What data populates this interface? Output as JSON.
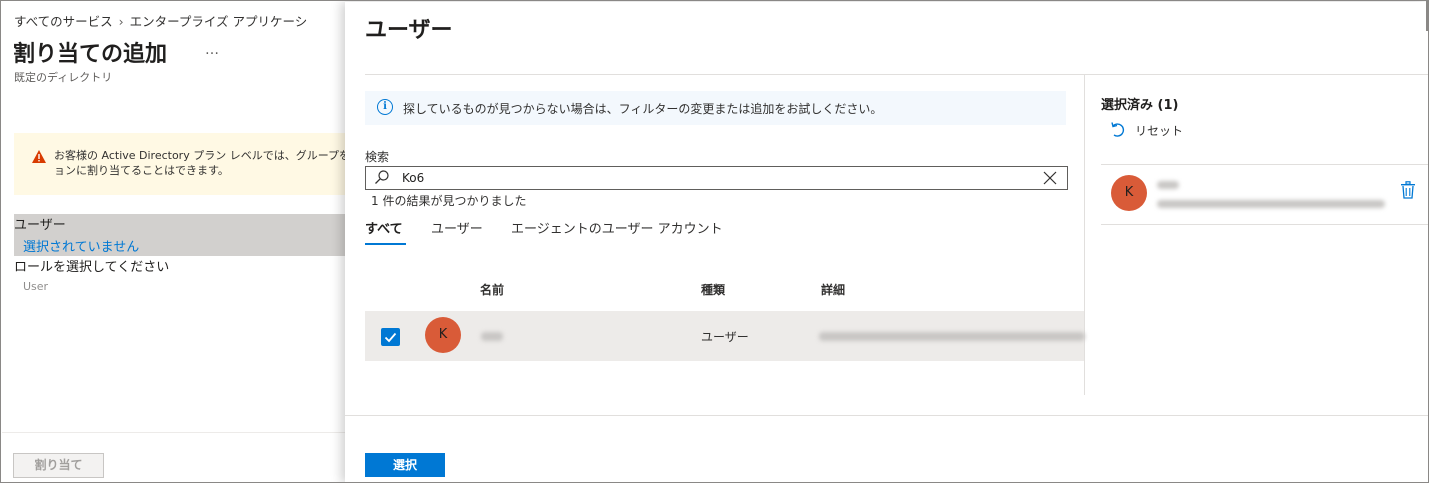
{
  "left_blade": {
    "breadcrumb": [
      "すべてのサービス",
      "エンタープライズ アプリケーシ"
    ],
    "title": "割り当ての追加",
    "more": "…",
    "subtitle": "既定のディレクトリ",
    "warning_line1": "お客様の Active Directory プラン レベルでは、グループを",
    "warning_line2": "ョンに割り当てることはできます。",
    "user_label": "ユーザー",
    "user_value": "選択されていません",
    "role_label": "ロールを選択してください",
    "role_value": "User",
    "assign_button": "割り当て"
  },
  "panel": {
    "title": "ユーザー",
    "info_text": "探しているものが見つからない場合は、フィルターの変更または追加をお試しください。",
    "search_label": "検索",
    "search_value": "Ko6",
    "result_count": "1 件の結果が見つかりました",
    "tabs": [
      "すべて",
      "ユーザー",
      "エージェントのユーザー アカウント"
    ],
    "columns": {
      "name": "名前",
      "type": "種類",
      "detail": "詳細"
    },
    "rows": [
      {
        "initial": "K",
        "type": "ユーザー",
        "checked": true
      }
    ],
    "selected_title": "選択済み (1)",
    "reset_label": "リセット",
    "selected_items": [
      {
        "initial": "K"
      }
    ],
    "select_button": "選択"
  },
  "colors": {
    "accent": "#0078d4",
    "avatar": "#d95b38",
    "warning_bg": "#fff4ce",
    "info_bg": "#f3f8fd"
  }
}
